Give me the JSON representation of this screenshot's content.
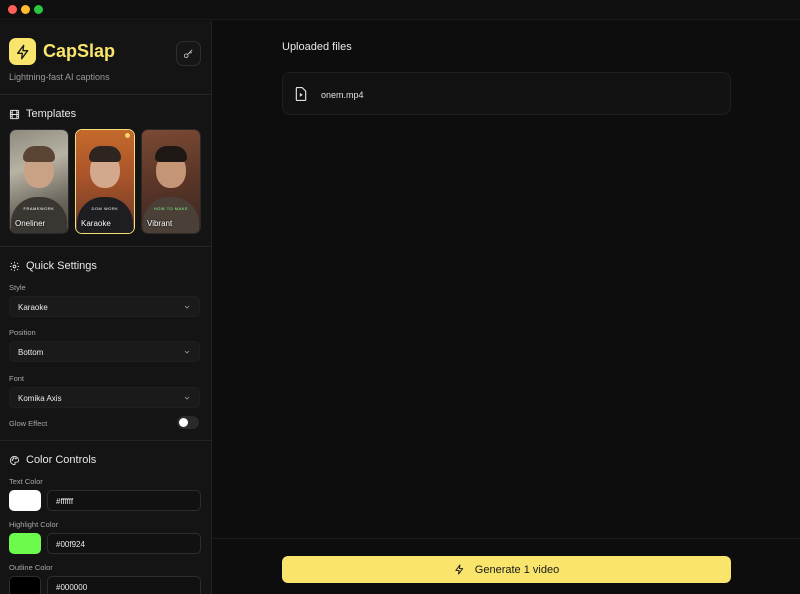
{
  "app": {
    "name": "CapSlap",
    "tagline": "Lightning-fast AI captions",
    "accent_color": "#f9e46c"
  },
  "templates": {
    "title": "Templates",
    "icon": "film-icon",
    "items": [
      {
        "label": "Oneliner",
        "caption": "FRAMEWORK",
        "selected": false
      },
      {
        "label": "Karaoke",
        "caption": "DOM WORK",
        "selected": true
      },
      {
        "label": "Vibrant",
        "caption": "HOW TO MAKE",
        "selected": false
      }
    ]
  },
  "quick_settings": {
    "title": "Quick Settings",
    "icon": "gear-icon",
    "style": {
      "label": "Style",
      "value": "Karaoke"
    },
    "position": {
      "label": "Position",
      "value": "Bottom"
    },
    "font": {
      "label": "Font",
      "value": "Komika Axis"
    },
    "glow": {
      "label": "Glow Effect",
      "enabled": false
    }
  },
  "color_controls": {
    "title": "Color Controls",
    "icon": "palette-icon",
    "text_color": {
      "label": "Text Color",
      "value": "#ffffff"
    },
    "highlight_color": {
      "label": "Highlight Color",
      "value": "#00f924"
    },
    "outline_color": {
      "label": "Outline Color",
      "value": "#000000"
    }
  },
  "main": {
    "uploaded_title": "Uploaded files",
    "files": [
      {
        "name": "onem.mp4",
        "icon": "video-file-icon"
      }
    ],
    "generate_label": "Generate 1 video"
  }
}
